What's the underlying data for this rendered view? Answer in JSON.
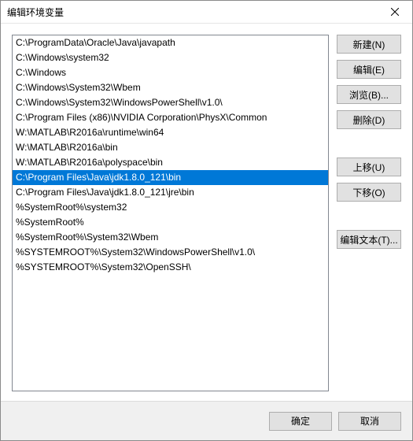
{
  "window": {
    "title": "编辑环境变量"
  },
  "list": {
    "items": [
      "C:\\ProgramData\\Oracle\\Java\\javapath",
      "C:\\Windows\\system32",
      "C:\\Windows",
      "C:\\Windows\\System32\\Wbem",
      "C:\\Windows\\System32\\WindowsPowerShell\\v1.0\\",
      "C:\\Program Files (x86)\\NVIDIA Corporation\\PhysX\\Common",
      "W:\\MATLAB\\R2016a\\runtime\\win64",
      "W:\\MATLAB\\R2016a\\bin",
      "W:\\MATLAB\\R2016a\\polyspace\\bin",
      "C:\\Program Files\\Java\\jdk1.8.0_121\\bin",
      "C:\\Program Files\\Java\\jdk1.8.0_121\\jre\\bin",
      "%SystemRoot%\\system32",
      "%SystemRoot%",
      "%SystemRoot%\\System32\\Wbem",
      "%SYSTEMROOT%\\System32\\WindowsPowerShell\\v1.0\\",
      "%SYSTEMROOT%\\System32\\OpenSSH\\"
    ],
    "selected_index": 9
  },
  "buttons": {
    "new": "新建(N)",
    "edit": "编辑(E)",
    "browse": "浏览(B)...",
    "delete": "删除(D)",
    "up": "上移(U)",
    "down": "下移(O)",
    "edit_text": "编辑文本(T)...",
    "ok": "确定",
    "cancel": "取消"
  }
}
